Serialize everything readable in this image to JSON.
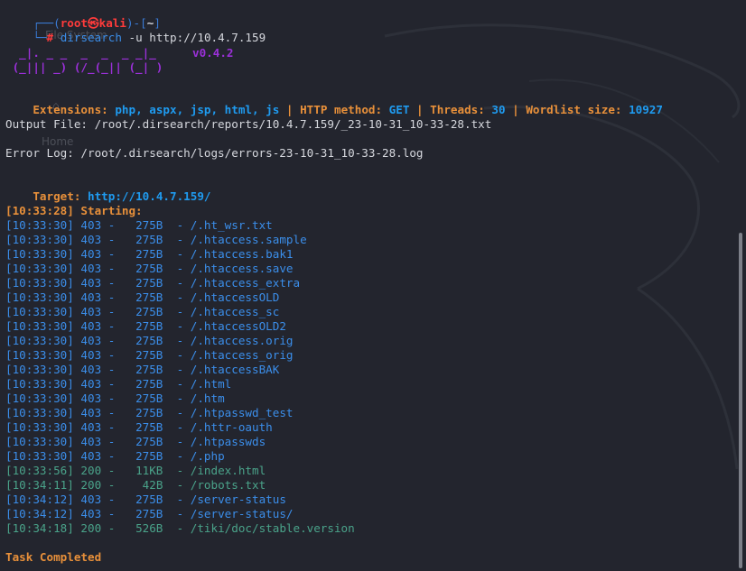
{
  "prompt": {
    "frame_top_left": "┌──(",
    "user": "root",
    "at_symbol": "㉿",
    "host": "kali",
    "dir_open": ")-[",
    "dir": "~",
    "dir_close": "]",
    "frame_bottom": "└─",
    "hash": "#",
    "command": "dirsearch",
    "args": " -u http://10.4.7.159"
  },
  "banner": {
    "line1": "  _|. _ _  _  _  _ _|_",
    "line2": " (_||| _) (/_(_|| (_| )",
    "version": "v0.4.2"
  },
  "config": {
    "ext_label": "Extensions: ",
    "ext_value": "php, aspx, jsp, html, js",
    "sep": " | ",
    "method_label": "HTTP method: ",
    "method_value": "GET",
    "threads_label": "Threads: ",
    "threads_value": "30",
    "wordlist_label": "Wordlist size: ",
    "wordlist_value": "10927"
  },
  "output_file": "Output File: /root/.dirsearch/reports/10.4.7.159/_23-10-31_10-33-28.txt",
  "error_log": "Error Log: /root/.dirsearch/logs/errors-23-10-31_10-33-28.log",
  "target": {
    "label": "Target: ",
    "url": "http://10.4.7.159/"
  },
  "starting": "[10:33:28] Starting:",
  "results": [
    {
      "time": "[10:33:30]",
      "code": "403",
      "size": "275B",
      "path": "/.ht_wsr.txt"
    },
    {
      "time": "[10:33:30]",
      "code": "403",
      "size": "275B",
      "path": "/.htaccess.sample"
    },
    {
      "time": "[10:33:30]",
      "code": "403",
      "size": "275B",
      "path": "/.htaccess.bak1"
    },
    {
      "time": "[10:33:30]",
      "code": "403",
      "size": "275B",
      "path": "/.htaccess.save"
    },
    {
      "time": "[10:33:30]",
      "code": "403",
      "size": "275B",
      "path": "/.htaccess_extra"
    },
    {
      "time": "[10:33:30]",
      "code": "403",
      "size": "275B",
      "path": "/.htaccessOLD"
    },
    {
      "time": "[10:33:30]",
      "code": "403",
      "size": "275B",
      "path": "/.htaccess_sc"
    },
    {
      "time": "[10:33:30]",
      "code": "403",
      "size": "275B",
      "path": "/.htaccessOLD2"
    },
    {
      "time": "[10:33:30]",
      "code": "403",
      "size": "275B",
      "path": "/.htaccess.orig"
    },
    {
      "time": "[10:33:30]",
      "code": "403",
      "size": "275B",
      "path": "/.htaccess_orig"
    },
    {
      "time": "[10:33:30]",
      "code": "403",
      "size": "275B",
      "path": "/.htaccessBAK"
    },
    {
      "time": "[10:33:30]",
      "code": "403",
      "size": "275B",
      "path": "/.html"
    },
    {
      "time": "[10:33:30]",
      "code": "403",
      "size": "275B",
      "path": "/.htm"
    },
    {
      "time": "[10:33:30]",
      "code": "403",
      "size": "275B",
      "path": "/.htpasswd_test"
    },
    {
      "time": "[10:33:30]",
      "code": "403",
      "size": "275B",
      "path": "/.httr-oauth"
    },
    {
      "time": "[10:33:30]",
      "code": "403",
      "size": "275B",
      "path": "/.htpasswds"
    },
    {
      "time": "[10:33:30]",
      "code": "403",
      "size": "275B",
      "path": "/.php"
    },
    {
      "time": "[10:33:56]",
      "code": "200",
      "size": "11KB",
      "path": "/index.html"
    },
    {
      "time": "[10:34:11]",
      "code": "200",
      "size": "42B",
      "path": "/robots.txt"
    },
    {
      "time": "[10:34:12]",
      "code": "403",
      "size": "275B",
      "path": "/server-status"
    },
    {
      "time": "[10:34:12]",
      "code": "403",
      "size": "275B",
      "path": "/server-status/"
    },
    {
      "time": "[10:34:18]",
      "code": "200",
      "size": "526B",
      "path": "/tiki/doc/stable.version"
    }
  ],
  "task_done": "Task Completed",
  "colors": {
    "bg": "#23252e",
    "code403": "#3b8eea",
    "code200": "#4aa38a",
    "accent_orange": "#e8903a",
    "accent_cyan": "#1f9bf0",
    "banner_purple": "#9b30d9"
  }
}
